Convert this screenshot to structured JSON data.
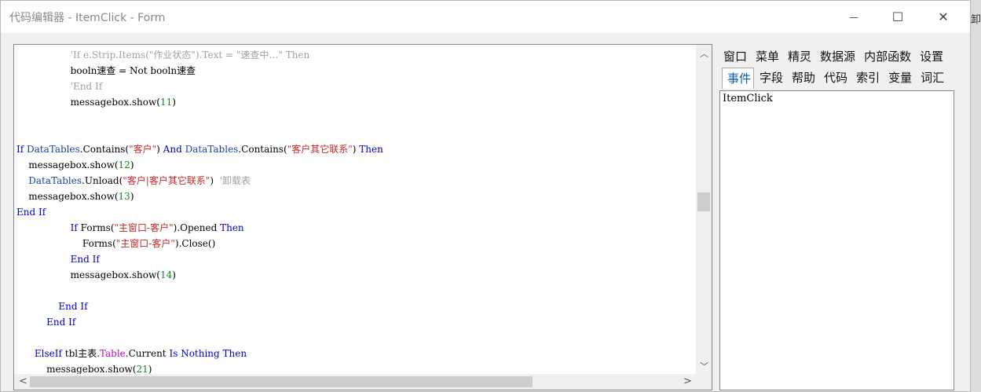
{
  "window": {
    "title": "代码编辑器 - ItemClick - Form",
    "minimize": "—",
    "maximize": "☐",
    "close": "✕"
  },
  "background_fragment": "卸",
  "editor": {
    "lines": [
      [
        {
          "t": "                  "
        },
        {
          "t": "'If e.Strip.Items(\"作业状态\").Text = \"速查中…\" Then",
          "c": "cmt"
        }
      ],
      [
        {
          "t": "                  booln速查 = Not booln速查"
        }
      ],
      [
        {
          "t": "                  "
        },
        {
          "t": "'End If",
          "c": "cmt"
        }
      ],
      [
        {
          "t": "                  messagebox.show("
        },
        {
          "t": "11",
          "c": "num"
        },
        {
          "t": ")"
        }
      ],
      [
        {
          "t": ""
        }
      ],
      [
        {
          "t": ""
        }
      ],
      [
        {
          "t": "If",
          "c": "kw"
        },
        {
          "t": " "
        },
        {
          "t": "DataTables",
          "c": "kw2"
        },
        {
          "t": ".Contains("
        },
        {
          "t": "\"客户\"",
          "c": "str"
        },
        {
          "t": ") "
        },
        {
          "t": "And",
          "c": "kw"
        },
        {
          "t": " "
        },
        {
          "t": "DataTables",
          "c": "kw2"
        },
        {
          "t": ".Contains("
        },
        {
          "t": "\"客户其它联系\"",
          "c": "str"
        },
        {
          "t": ") "
        },
        {
          "t": "Then",
          "c": "kw"
        }
      ],
      [
        {
          "t": "    messagebox.show("
        },
        {
          "t": "12",
          "c": "num"
        },
        {
          "t": ")"
        }
      ],
      [
        {
          "t": "    "
        },
        {
          "t": "DataTables",
          "c": "kw2"
        },
        {
          "t": ".Unload("
        },
        {
          "t": "\"客户|客户其它联系\"",
          "c": "str"
        },
        {
          "t": ")  "
        },
        {
          "t": "'卸载表",
          "c": "cmt"
        }
      ],
      [
        {
          "t": "    messagebox.show("
        },
        {
          "t": "13",
          "c": "num"
        },
        {
          "t": ")"
        }
      ],
      [
        {
          "t": "End If",
          "c": "kw"
        }
      ],
      [
        {
          "t": "                  "
        },
        {
          "t": "If",
          "c": "kw"
        },
        {
          "t": " Forms("
        },
        {
          "t": "\"主窗口-客户\"",
          "c": "str"
        },
        {
          "t": ").Opened "
        },
        {
          "t": "Then",
          "c": "kw"
        }
      ],
      [
        {
          "t": "                      Forms("
        },
        {
          "t": "\"主窗口-客户\"",
          "c": "str"
        },
        {
          "t": ").Close()"
        }
      ],
      [
        {
          "t": "                  "
        },
        {
          "t": "End If",
          "c": "kw"
        }
      ],
      [
        {
          "t": "                  messagebox.show("
        },
        {
          "t": "14",
          "c": "num"
        },
        {
          "t": ")"
        }
      ],
      [
        {
          "t": ""
        }
      ],
      [
        {
          "t": "              "
        },
        {
          "t": "End If",
          "c": "kw"
        }
      ],
      [
        {
          "t": "          "
        },
        {
          "t": "End If",
          "c": "kw"
        }
      ],
      [
        {
          "t": ""
        }
      ],
      [
        {
          "t": "      "
        },
        {
          "t": "ElseIf",
          "c": "kw"
        },
        {
          "t": " tbl主表."
        },
        {
          "t": "Table",
          "c": "mag"
        },
        {
          "t": ".Current "
        },
        {
          "t": "Is",
          "c": "kw"
        },
        {
          "t": " "
        },
        {
          "t": "Nothing",
          "c": "kw"
        },
        {
          "t": " "
        },
        {
          "t": "Then",
          "c": "kw"
        }
      ],
      [
        {
          "t": "          messagebox.show("
        },
        {
          "t": "21",
          "c": "num"
        },
        {
          "t": ")"
        }
      ]
    ]
  },
  "panel": {
    "tabs_row1": [
      "窗口",
      "菜单",
      "精灵",
      "数据源",
      "内部函数",
      "设置"
    ],
    "tabs_row2": [
      "事件",
      "字段",
      "帮助",
      "代码",
      "索引",
      "变量",
      "词汇"
    ],
    "active_tab": "事件",
    "list_items": [
      "ItemClick"
    ]
  },
  "scroll": {
    "up": "︿",
    "down": "﹀",
    "left": "<",
    "right": ">"
  }
}
